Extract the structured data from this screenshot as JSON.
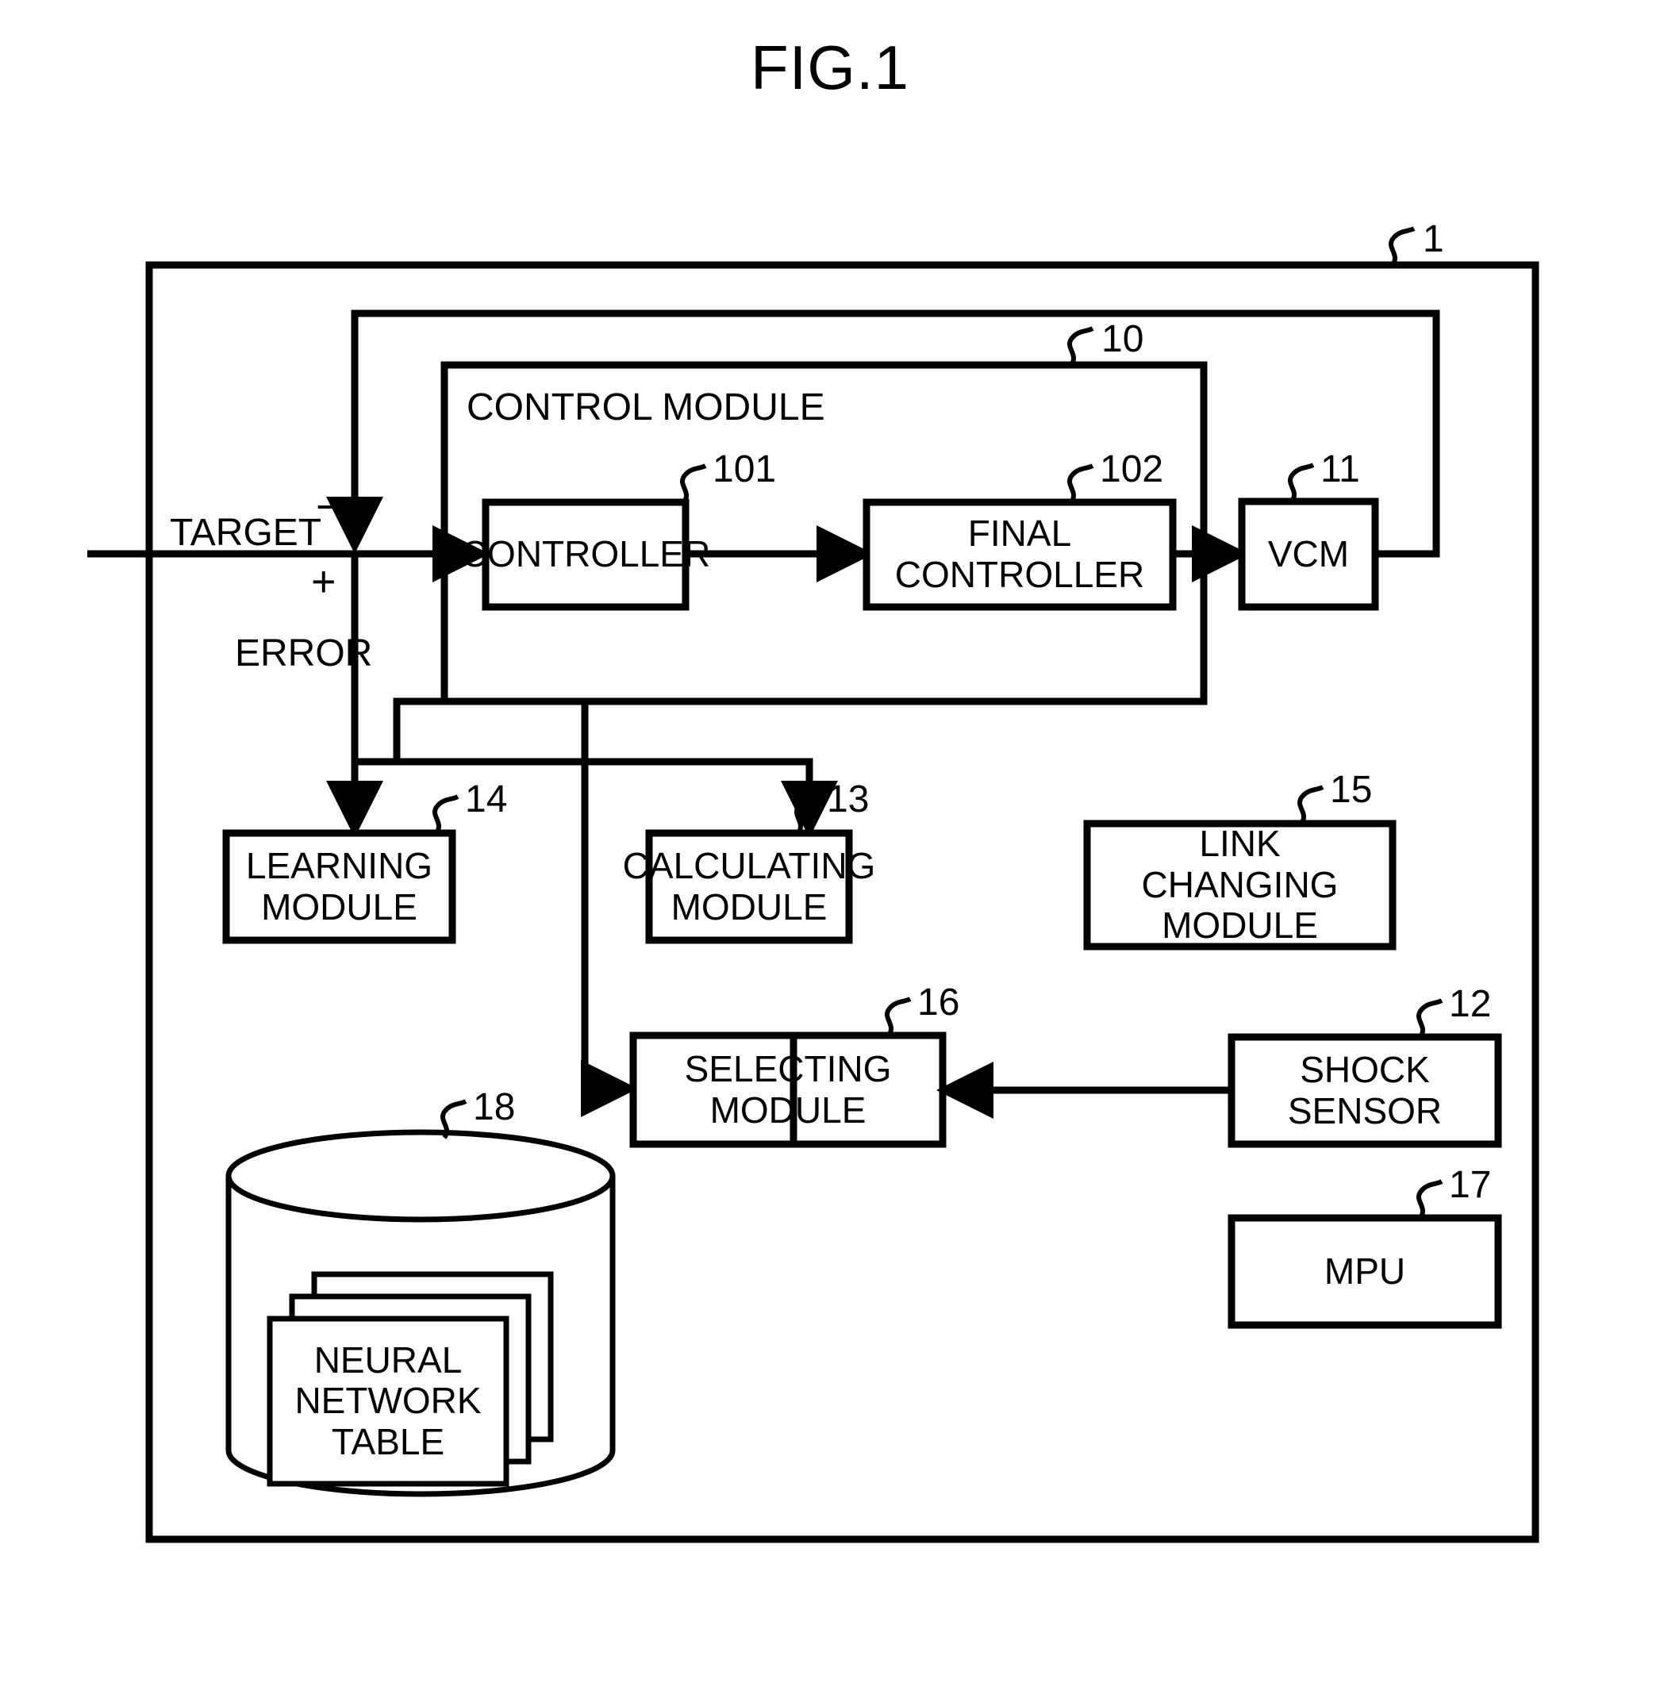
{
  "figure": {
    "title": "FIG.1"
  },
  "signals": {
    "target_label": "TARGET",
    "minus_sign": "−",
    "plus_sign": "+",
    "error_label": "ERROR"
  },
  "system": {
    "ref": "1"
  },
  "control_module": {
    "title": "CONTROL MODULE",
    "ref": "10",
    "blocks": [
      {
        "label": "CONTROLLER",
        "ref": "101"
      },
      {
        "label": "FINAL\nCONTROLLER",
        "ref": "102"
      }
    ]
  },
  "blocks": [
    {
      "label": "VCM",
      "ref": "11"
    },
    {
      "label": "LEARNING\nMODULE",
      "ref": "14"
    },
    {
      "label": "CALCULATING\nMODULE",
      "ref": "13"
    },
    {
      "label": "LINK\nCHANGING\nMODULE",
      "ref": "15"
    },
    {
      "label": "SELECTING\nMODULE",
      "ref": "16"
    },
    {
      "label": "SHOCK\nSENSOR",
      "ref": "12"
    },
    {
      "label": "MPU",
      "ref": "17"
    }
  ],
  "storage": {
    "label": "NEURAL\nNETWORK\nTABLE",
    "ref": "18"
  },
  "colors": {
    "stroke": "#000000",
    "background": "#ffffff"
  }
}
